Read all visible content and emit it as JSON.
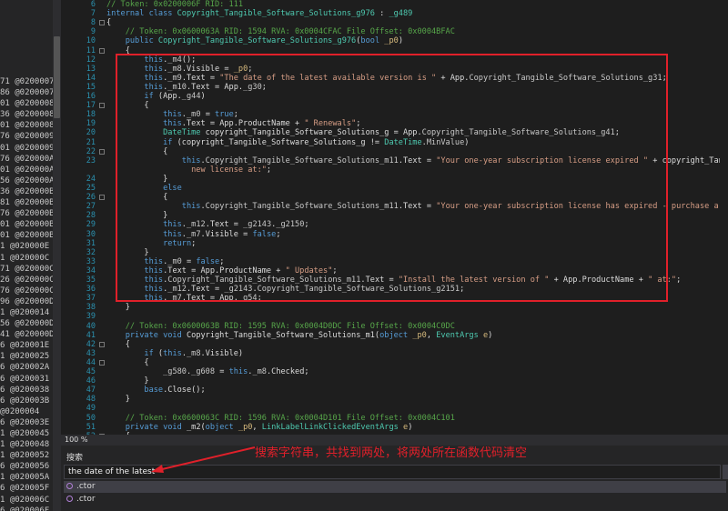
{
  "left_pane": {
    "items": [
      "71 @0200007",
      "86 @0200007",
      "01 @0200008",
      "36 @0200008",
      "01 @0200008",
      "76 @0200009",
      "01 @0200009",
      "76 @020000A",
      "01 @020000A",
      "56 @020000A",
      "36 @020000B",
      "81 @020000B",
      "76 @020000B",
      "01 @020000B",
      "01 @020000B",
      "1 @020000E",
      "1 @020000C",
      "71 @020000C",
      "26 @020000C",
      "76 @020000C",
      "96 @020000D",
      "1 @0200014",
      "56 @020000D",
      "41 @020000D",
      "6 @020001E",
      "1 @0200025",
      "6 @020002A",
      "6 @0200031",
      "6 @0200038",
      "6 @020003B",
      "@0200004",
      "6 @020003E",
      "1 @0200045",
      "1 @0200048",
      "1 @0200052",
      "6 @0200056",
      "1 @020005A",
      "6 @020005F",
      "1 @020006C",
      "6 @020006F"
    ]
  },
  "editor": {
    "lines": [
      {
        "n": "6",
        "segs": [
          {
            "c": "cm",
            "t": "// Token: 0x0200006F RID: 111"
          }
        ]
      },
      {
        "n": "7",
        "segs": [
          {
            "c": "kw",
            "t": "internal class "
          },
          {
            "c": "ty",
            "t": "Copyright_Tangible_Software_Solutions_g976"
          },
          {
            "c": "",
            "t": " : "
          },
          {
            "c": "ty",
            "t": "_g489"
          }
        ]
      },
      {
        "n": "8",
        "segs": [
          {
            "c": "",
            "t": "{"
          }
        ]
      },
      {
        "n": "9",
        "segs": [
          {
            "c": "cm",
            "t": "    // Token: 0x0600063A RID: 1594 RVA: 0x0004CFAC File Offset: 0x0004BFAC"
          }
        ]
      },
      {
        "n": "10",
        "segs": [
          {
            "c": "kw",
            "t": "    public "
          },
          {
            "c": "ty",
            "t": "Copyright_Tangible_Software_Solutions_g976"
          },
          {
            "c": "",
            "t": "("
          },
          {
            "c": "kw",
            "t": "bool "
          },
          {
            "c": "pr",
            "t": "_p0"
          },
          {
            "c": "",
            "t": ")"
          }
        ]
      },
      {
        "n": "11",
        "segs": [
          {
            "c": "",
            "t": "    {"
          }
        ]
      },
      {
        "n": "12",
        "segs": [
          {
            "c": "kw",
            "t": "        this"
          },
          {
            "c": "",
            "t": "."
          },
          {
            "c": "mb",
            "t": "_m4"
          },
          {
            "c": "",
            "t": "();"
          }
        ]
      },
      {
        "n": "13",
        "segs": [
          {
            "c": "kw",
            "t": "        this"
          },
          {
            "c": "",
            "t": "."
          },
          {
            "c": "mb",
            "t": "_m8"
          },
          {
            "c": "",
            "t": ".Visible = "
          },
          {
            "c": "pr",
            "t": "_p0"
          },
          {
            "c": "",
            "t": ";"
          }
        ]
      },
      {
        "n": "14",
        "segs": [
          {
            "c": "kw",
            "t": "        this"
          },
          {
            "c": "",
            "t": "."
          },
          {
            "c": "mb",
            "t": "_m9"
          },
          {
            "c": "",
            "t": ".Text = "
          },
          {
            "c": "st",
            "t": "\"The date of the latest available version is \""
          },
          {
            "c": "",
            "t": " + App."
          },
          {
            "c": "mb",
            "t": "Copyright_Tangible_Software_Solutions_g31"
          },
          {
            "c": "",
            "t": ";"
          }
        ]
      },
      {
        "n": "15",
        "segs": [
          {
            "c": "kw",
            "t": "        this"
          },
          {
            "c": "",
            "t": "."
          },
          {
            "c": "mb",
            "t": "_m10"
          },
          {
            "c": "",
            "t": ".Text = App."
          },
          {
            "c": "mb",
            "t": "_g30"
          },
          {
            "c": "",
            "t": ";"
          }
        ]
      },
      {
        "n": "16",
        "segs": [
          {
            "c": "kw",
            "t": "        if "
          },
          {
            "c": "",
            "t": "(App."
          },
          {
            "c": "mb",
            "t": "_g44"
          },
          {
            "c": "",
            "t": ")"
          }
        ]
      },
      {
        "n": "17",
        "segs": [
          {
            "c": "",
            "t": "        {"
          }
        ]
      },
      {
        "n": "18",
        "segs": [
          {
            "c": "kw",
            "t": "            this"
          },
          {
            "c": "",
            "t": "."
          },
          {
            "c": "mb",
            "t": "_m0"
          },
          {
            "c": "",
            "t": " = "
          },
          {
            "c": "kw",
            "t": "true"
          },
          {
            "c": "",
            "t": ";"
          }
        ]
      },
      {
        "n": "19",
        "segs": [
          {
            "c": "kw",
            "t": "            this"
          },
          {
            "c": "",
            "t": ".Text = App.ProductName + "
          },
          {
            "c": "st",
            "t": "\" Renewals\""
          },
          {
            "c": "",
            "t": ";"
          }
        ]
      },
      {
        "n": "20",
        "segs": [
          {
            "c": "ty",
            "t": "            DateTime "
          },
          {
            "c": "",
            "t": "copyright_Tangible_Software_Solutions_g = App."
          },
          {
            "c": "mb",
            "t": "Copyright_Tangible_Software_Solutions_g41"
          },
          {
            "c": "",
            "t": ";"
          }
        ]
      },
      {
        "n": "21",
        "segs": [
          {
            "c": "kw",
            "t": "            if "
          },
          {
            "c": "",
            "t": "(copyright_Tangible_Software_Solutions_g != "
          },
          {
            "c": "ty",
            "t": "DateTime"
          },
          {
            "c": "",
            "t": "."
          },
          {
            "c": "mb",
            "t": "MinValue"
          },
          {
            "c": "",
            "t": ")"
          }
        ]
      },
      {
        "n": "22",
        "segs": [
          {
            "c": "",
            "t": "            {"
          }
        ]
      },
      {
        "n": "23",
        "segs": [
          {
            "c": "kw",
            "t": "                this"
          },
          {
            "c": "",
            "t": "."
          },
          {
            "c": "mb",
            "t": "Copyright_Tangible_Software_Solutions_m11"
          },
          {
            "c": "",
            "t": ".Text = "
          },
          {
            "c": "st",
            "t": "\"Your one-year subscription license expired \""
          },
          {
            "c": "",
            "t": " + copyright_Tangible_Software_S"
          }
        ]
      },
      {
        "n": "",
        "segs": [
          {
            "c": "st",
            "t": "                  new license at:\""
          },
          {
            "c": "",
            "t": ";"
          }
        ]
      },
      {
        "n": "24",
        "segs": [
          {
            "c": "",
            "t": "            }"
          }
        ]
      },
      {
        "n": "25",
        "segs": [
          {
            "c": "kw",
            "t": "            else"
          }
        ]
      },
      {
        "n": "26",
        "segs": [
          {
            "c": "",
            "t": "            {"
          }
        ]
      },
      {
        "n": "27",
        "segs": [
          {
            "c": "kw",
            "t": "                this"
          },
          {
            "c": "",
            "t": "."
          },
          {
            "c": "mb",
            "t": "Copyright_Tangible_Software_Solutions_m11"
          },
          {
            "c": "",
            "t": ".Text = "
          },
          {
            "c": "st",
            "t": "\"Your one-year subscription license has expired - purchase a new license at:\""
          }
        ]
      },
      {
        "n": "28",
        "segs": [
          {
            "c": "",
            "t": "            }"
          }
        ]
      },
      {
        "n": "29",
        "segs": [
          {
            "c": "kw",
            "t": "            this"
          },
          {
            "c": "",
            "t": "."
          },
          {
            "c": "mb",
            "t": "_m12"
          },
          {
            "c": "",
            "t": ".Text = "
          },
          {
            "c": "mb",
            "t": "_g2143"
          },
          {
            "c": "",
            "t": "."
          },
          {
            "c": "mb",
            "t": "_g2150"
          },
          {
            "c": "",
            "t": ";"
          }
        ]
      },
      {
        "n": "30",
        "segs": [
          {
            "c": "kw",
            "t": "            this"
          },
          {
            "c": "",
            "t": "."
          },
          {
            "c": "mb",
            "t": "_m7"
          },
          {
            "c": "",
            "t": ".Visible = "
          },
          {
            "c": "kw",
            "t": "false"
          },
          {
            "c": "",
            "t": ";"
          }
        ]
      },
      {
        "n": "31",
        "segs": [
          {
            "c": "kw",
            "t": "            return"
          },
          {
            "c": "",
            "t": ";"
          }
        ]
      },
      {
        "n": "32",
        "segs": [
          {
            "c": "",
            "t": "        }"
          }
        ]
      },
      {
        "n": "33",
        "segs": [
          {
            "c": "kw",
            "t": "        this"
          },
          {
            "c": "",
            "t": "."
          },
          {
            "c": "mb",
            "t": "_m0"
          },
          {
            "c": "",
            "t": " = "
          },
          {
            "c": "kw",
            "t": "false"
          },
          {
            "c": "",
            "t": ";"
          }
        ]
      },
      {
        "n": "34",
        "segs": [
          {
            "c": "kw",
            "t": "        this"
          },
          {
            "c": "",
            "t": ".Text = App.ProductName + "
          },
          {
            "c": "st",
            "t": "\" Updates\""
          },
          {
            "c": "",
            "t": ";"
          }
        ]
      },
      {
        "n": "35",
        "segs": [
          {
            "c": "kw",
            "t": "        this"
          },
          {
            "c": "",
            "t": "."
          },
          {
            "c": "mb",
            "t": "Copyright_Tangible_Software_Solutions_m11"
          },
          {
            "c": "",
            "t": ".Text = "
          },
          {
            "c": "st",
            "t": "\"Install the latest version of \""
          },
          {
            "c": "",
            "t": " + App.ProductName + "
          },
          {
            "c": "st",
            "t": "\" at:\""
          },
          {
            "c": "",
            "t": ";"
          }
        ]
      },
      {
        "n": "36",
        "segs": [
          {
            "c": "kw",
            "t": "        this"
          },
          {
            "c": "",
            "t": "."
          },
          {
            "c": "mb",
            "t": "_m12"
          },
          {
            "c": "",
            "t": ".Text = "
          },
          {
            "c": "mb",
            "t": "_g2143"
          },
          {
            "c": "",
            "t": "."
          },
          {
            "c": "mb",
            "t": "Copyright_Tangible_Software_Solutions_g2151"
          },
          {
            "c": "",
            "t": ";"
          }
        ]
      },
      {
        "n": "37",
        "segs": [
          {
            "c": "kw",
            "t": "        this"
          },
          {
            "c": "",
            "t": "."
          },
          {
            "c": "mb",
            "t": "_m7"
          },
          {
            "c": "",
            "t": ".Text = App."
          },
          {
            "c": "mb",
            "t": "_g54"
          },
          {
            "c": "",
            "t": ";"
          }
        ]
      },
      {
        "n": "38",
        "segs": [
          {
            "c": "",
            "t": "    }"
          }
        ]
      },
      {
        "n": "39",
        "segs": [
          {
            "c": "",
            "t": ""
          }
        ]
      },
      {
        "n": "40",
        "segs": [
          {
            "c": "cm",
            "t": "    // Token: 0x0600063B RID: 1595 RVA: 0x0004D0DC File Offset: 0x0004C0DC"
          }
        ]
      },
      {
        "n": "41",
        "segs": [
          {
            "c": "kw",
            "t": "    private void "
          },
          {
            "c": "",
            "t": "Copyright_Tangible_Software_Solutions_m1("
          },
          {
            "c": "kw",
            "t": "object "
          },
          {
            "c": "pr",
            "t": "_p0"
          },
          {
            "c": "",
            "t": ", "
          },
          {
            "c": "ty",
            "t": "EventArgs "
          },
          {
            "c": "pr",
            "t": "e"
          },
          {
            "c": "",
            "t": ")"
          }
        ]
      },
      {
        "n": "42",
        "segs": [
          {
            "c": "",
            "t": "    {"
          }
        ]
      },
      {
        "n": "43",
        "segs": [
          {
            "c": "kw",
            "t": "        if "
          },
          {
            "c": "",
            "t": "("
          },
          {
            "c": "kw",
            "t": "this"
          },
          {
            "c": "",
            "t": "."
          },
          {
            "c": "mb",
            "t": "_m8"
          },
          {
            "c": "",
            "t": ".Visible)"
          }
        ]
      },
      {
        "n": "44",
        "segs": [
          {
            "c": "",
            "t": "        {"
          }
        ]
      },
      {
        "n": "45",
        "segs": [
          {
            "c": "",
            "t": "            "
          },
          {
            "c": "mb",
            "t": "_g580"
          },
          {
            "c": "",
            "t": "."
          },
          {
            "c": "mb",
            "t": "_g608"
          },
          {
            "c": "",
            "t": " = "
          },
          {
            "c": "kw",
            "t": "this"
          },
          {
            "c": "",
            "t": "."
          },
          {
            "c": "mb",
            "t": "_m8"
          },
          {
            "c": "",
            "t": ".Checked;"
          }
        ]
      },
      {
        "n": "46",
        "segs": [
          {
            "c": "",
            "t": "        }"
          }
        ]
      },
      {
        "n": "47",
        "segs": [
          {
            "c": "kw",
            "t": "        base"
          },
          {
            "c": "",
            "t": ".Close();"
          }
        ]
      },
      {
        "n": "48",
        "segs": [
          {
            "c": "",
            "t": "    }"
          }
        ]
      },
      {
        "n": "49",
        "segs": [
          {
            "c": "",
            "t": ""
          }
        ]
      },
      {
        "n": "50",
        "segs": [
          {
            "c": "cm",
            "t": "    // Token: 0x0600063C RID: 1596 RVA: 0x0004D101 File Offset: 0x0004C101"
          }
        ]
      },
      {
        "n": "51",
        "segs": [
          {
            "c": "kw",
            "t": "    private void "
          },
          {
            "c": "",
            "t": "_m2("
          },
          {
            "c": "kw",
            "t": "object "
          },
          {
            "c": "pr",
            "t": "_p0"
          },
          {
            "c": "",
            "t": ", "
          },
          {
            "c": "ty",
            "t": "LinkLabelLinkClickedEventArgs "
          },
          {
            "c": "pr",
            "t": "e"
          },
          {
            "c": "",
            "t": ")"
          }
        ]
      },
      {
        "n": "52",
        "segs": [
          {
            "c": "",
            "t": "    {"
          }
        ]
      }
    ]
  },
  "status_bar": {
    "zoom": "100 %"
  },
  "search": {
    "header": "搜索",
    "query": "the date of the latest",
    "results": [
      ".ctor",
      ".ctor"
    ]
  },
  "annotation": {
    "text": "搜索字符串，共找到两处，将两处所在函数代码清空",
    "color": "#e0202a"
  }
}
